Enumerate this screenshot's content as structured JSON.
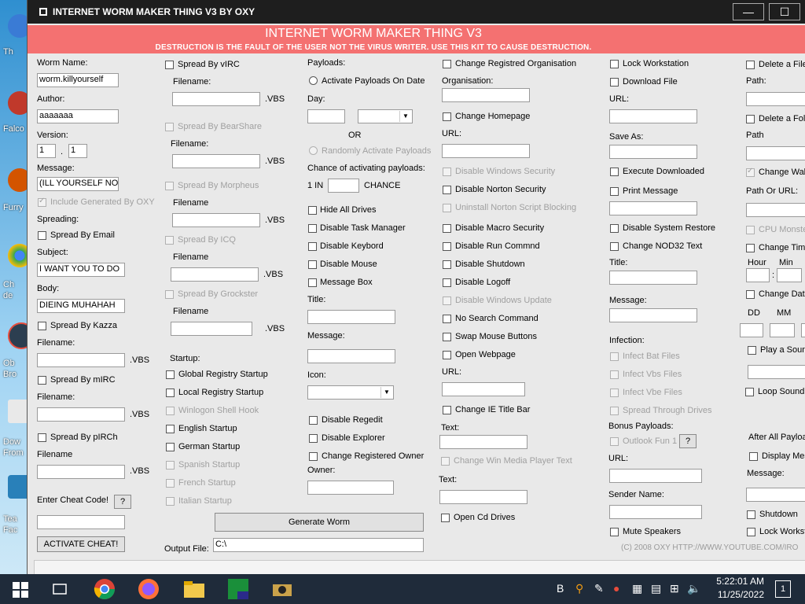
{
  "window": {
    "title": "INTERNET WORM MAKER THING V3  BY OXY",
    "minimize_label": "—",
    "maximize_label": "☐"
  },
  "banner": {
    "title": "INTERNET WORM MAKER THING V3",
    "subtitle": "DESTRUCTION IS THE FAULT OF THE USER NOT THE VIRUS WRITER. USE THIS KIT TO CAUSE DESTRUCTION."
  },
  "desktop": {
    "labels": [
      "Th",
      "Falco",
      "Furry",
      "Ch",
      "de",
      "Ob",
      "Bro",
      "Dow",
      "From",
      "Tea",
      "Fac"
    ]
  },
  "col1": {
    "worm_name_label": "Worm Name:",
    "worm_name_value": "worm.killyourself",
    "author_label": "Author:",
    "author_value": "aaaaaaa",
    "version_label": "Version:",
    "version_major": "1",
    "version_dot": ".",
    "version_minor": "1",
    "message_label": "Message:",
    "message_value": "(ILL YOURSELF NOW",
    "include_generated": "Include Generated By OXY",
    "spreading_label": "Spreading:",
    "spread_email": "Spread By Email",
    "subject_label": "Subject:",
    "subject_value": "I WANT YOU TO DO",
    "body_label": "Body:",
    "body_value": "DIEING MUHAHAH",
    "spread_kazza": "Spread By Kazza",
    "filename_label": "Filename:",
    "vbs": ".VBS",
    "spread_mirc": "Spread By mIRC",
    "filename_label2": "Filename:",
    "spread_pirch": "Spread By pIRCh",
    "filename_label3": "Filename",
    "cheat_label": "Enter Cheat Code!",
    "cheat_help": "?",
    "activate_cheat": "ACTIVATE CHEAT!"
  },
  "col2": {
    "spread_virc": "Spread By vIRC",
    "filename1": "Filename:",
    "spread_bearshare": "Spread By BearShare",
    "filename2": "Filename:",
    "spread_morpheus": "Spread By Morpheus",
    "filename3": "Filename",
    "spread_icq": "Spread By ICQ",
    "filename4": "Filename",
    "spread_grockster": "Spread By Grockster",
    "filename5": "Filename",
    "vbs": ".VBS",
    "startup_label": "Startup:",
    "global_registry": "Global Registry Startup",
    "local_registry": "Local Registry Startup",
    "winlogon": "Winlogon Shell Hook",
    "english": "English Startup",
    "german": "German Startup",
    "spanish": "Spanish Startup",
    "french": "French Startup",
    "italian": "Italian Startup",
    "output_file_label": "Output File:",
    "output_file_value": "C:\\",
    "generate_worm": "Generate Worm"
  },
  "col3": {
    "payloads_label": "Payloads:",
    "activate_on_date": "Activate Payloads On Date",
    "day_label": "Day:",
    "or_label": "OR",
    "randomly_activate": "Randomly Activate Payloads",
    "chance_label": "Chance of activating payloads:",
    "one_in": "1 IN",
    "chance": "CHANCE",
    "hide_drives": "Hide All Drives",
    "disable_task_manager": "Disable Task Manager",
    "disable_keybord": "Disable Keybord",
    "disable_mouse": "Disable Mouse",
    "message_box": "Message Box",
    "title_label": "Title:",
    "message_label": "Message:",
    "icon_label": "Icon:",
    "disable_regedit": "Disable Regedit",
    "disable_explorer": "Disable Explorer",
    "change_registered_owner": "Change Registered Owner",
    "owner_label": "Owner:"
  },
  "col4": {
    "change_org": "Change Registred Organisation",
    "organisation_label": "Organisation:",
    "change_homepage": "Change Homepage",
    "url_label": "URL:",
    "disable_windows_security": "Disable Windows Security",
    "disable_norton": "Disable Norton Security",
    "uninstall_norton": "Uninstall Norton Script Blocking",
    "disable_macro": "Disable Macro Security",
    "disable_run": "Disable Run Commnd",
    "disable_shutdown": "Disable Shutdown",
    "disable_logoff": "Disable Logoff",
    "disable_windows_update": "Disable Windows Update",
    "no_search": "No Search Command",
    "swap_mouse": "Swap Mouse Buttons",
    "open_webpage": "Open Webpage",
    "url_label2": "URL:",
    "change_ie_title": "Change IE Title Bar",
    "text_label": "Text:",
    "change_wmp_text": "Change Win Media Player Text",
    "text_label2": "Text:",
    "open_cd": "Open Cd Drives"
  },
  "col5": {
    "lock_workstation": "Lock Workstation",
    "download_file": "Download File",
    "url_label": "URL:",
    "save_as_label": "Save As:",
    "execute_downloaded": "Execute Downloaded",
    "print_message": "Print Message",
    "disable_system_restore": "Disable System Restore",
    "change_nod32": "Change NOD32 Text",
    "title_label": "Title:",
    "message_label": "Message:",
    "infection_label": "Infection:",
    "infect_bat": "Infect Bat Files",
    "infect_vbs": "Infect Vbs Files",
    "infect_vbe": "Infect Vbe Files",
    "spread_drives": "Spread Through Drives",
    "bonus_payloads": "Bonus Payloads:",
    "outlook_fun": "Outlook Fun 1",
    "outlook_help": "?",
    "url_label2": "URL:",
    "sender_name_label": "Sender Name:",
    "mute_speakers": "Mute Speakers",
    "copyright": "(C) 2008 OXY HTTP://WWW.YOUTUBE.COM/IRO"
  },
  "col6": {
    "delete_file": "Delete a File",
    "path_label": "Path:",
    "delete_folder": "Delete a Fold",
    "path_label2": "Path",
    "change_wallpaper": "Change Wall",
    "path_or_url": "Path Or URL:",
    "cpu_monster": "CPU Monster",
    "change_time": "Change Time",
    "hour_label": "Hour",
    "min_label": "Min",
    "colon": ":",
    "change_date": "Change Date",
    "dd_label": "DD",
    "mm_label": "MM",
    "play_sound": "Play a Soun",
    "loop_sound": "Loop Sound",
    "after_all_payloads": "After All Payloa",
    "display_message": "Display Mes",
    "message_label": "Message:",
    "shutdown": "Shutdown",
    "lock_workstation": "Lock Workst"
  },
  "taskbar": {
    "time": "5:22:01 AM",
    "date": "11/25/2022",
    "notification_count": "1"
  }
}
